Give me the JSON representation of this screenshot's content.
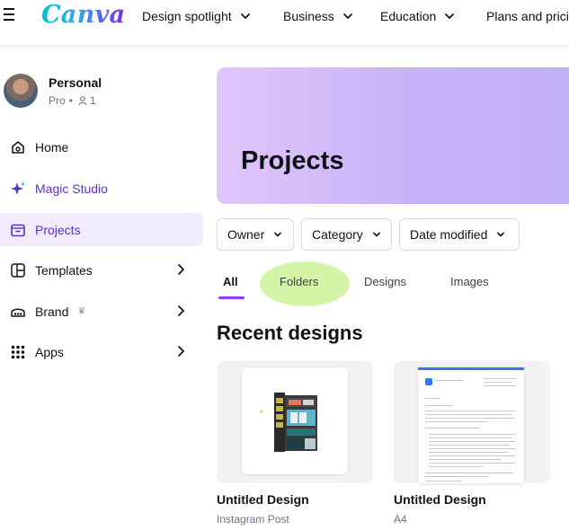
{
  "topbar": {
    "logo": "Canva",
    "nav": [
      {
        "label": "Design spotlight"
      },
      {
        "label": "Business"
      },
      {
        "label": "Education"
      },
      {
        "label": "Plans and prici"
      }
    ]
  },
  "profile": {
    "name": "Personal",
    "plan": "Pro",
    "separator": "•",
    "members": "1"
  },
  "sidebar": {
    "items": [
      {
        "label": "Home",
        "icon": "home-icon"
      },
      {
        "label": "Magic Studio",
        "icon": "sparkle-icon"
      },
      {
        "label": "Projects",
        "icon": "folder-icon"
      },
      {
        "label": "Templates",
        "icon": "templates-icon"
      },
      {
        "label": "Brand",
        "icon": "brand-icon"
      },
      {
        "label": "Apps",
        "icon": "apps-grid-icon"
      }
    ]
  },
  "hero": {
    "title": "Projects"
  },
  "filters": [
    {
      "label": "Owner"
    },
    {
      "label": "Category"
    },
    {
      "label": "Date modified"
    }
  ],
  "tabs": [
    {
      "label": "All"
    },
    {
      "label": "Folders"
    },
    {
      "label": "Designs"
    },
    {
      "label": "Images"
    }
  ],
  "recent": {
    "title": "Recent designs",
    "designs": [
      {
        "title": "Untitled Design",
        "type": "Instagram Post"
      },
      {
        "title": "Untitled Design",
        "type": "A4"
      }
    ]
  },
  "colors": {
    "accent": "#8b3dff",
    "active_bg": "#f0ebfd",
    "highlight": "#ccf299"
  }
}
